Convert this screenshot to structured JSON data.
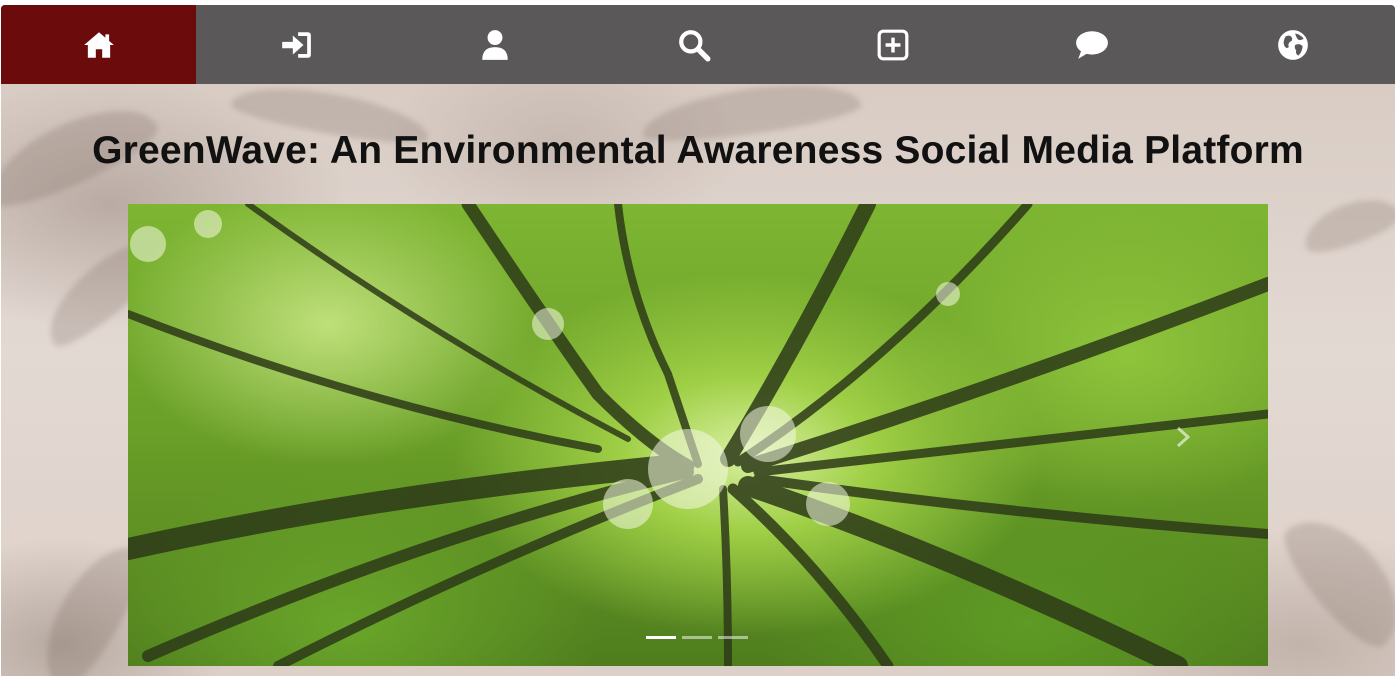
{
  "nav": {
    "items": [
      {
        "icon": "home-icon",
        "active": true
      },
      {
        "icon": "sign-in-icon",
        "active": false
      },
      {
        "icon": "user-icon",
        "active": false
      },
      {
        "icon": "search-icon",
        "active": false
      },
      {
        "icon": "add-post-icon",
        "active": false
      },
      {
        "icon": "chat-icon",
        "active": false
      },
      {
        "icon": "globe-icon",
        "active": false
      }
    ],
    "colors": {
      "bar": "#5a5859",
      "active": "#6b0b0b",
      "icon": "#ffffff"
    }
  },
  "main": {
    "title": "GreenWave: An Environmental Awareness Social Media Platform"
  },
  "carousel": {
    "slide_count": 3,
    "active_slide": 1,
    "image": "forest-canopy-photo"
  }
}
